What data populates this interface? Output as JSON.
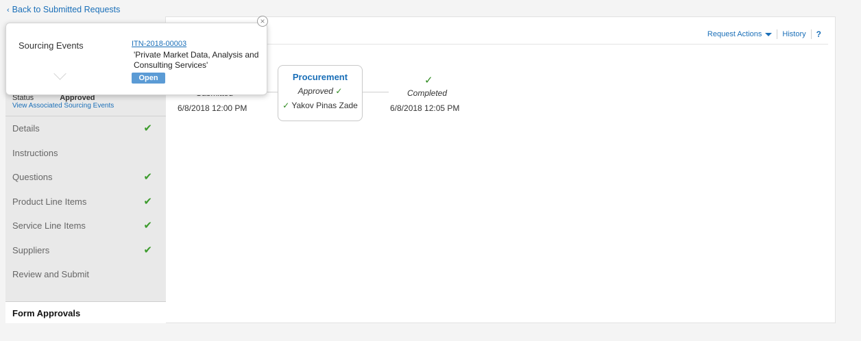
{
  "back_link": {
    "label": "Back to Submitted Requests"
  },
  "actions": {
    "request_actions": "Request Actions",
    "history": "History",
    "help": "?"
  },
  "flow": {
    "submitted": {
      "label": "Submitted",
      "date": "6/8/2018 12:00 PM"
    },
    "procurement": {
      "title": "Procurement",
      "status": "Approved",
      "approver": "Yakov Pinas Zade"
    },
    "completed": {
      "label": "Completed",
      "date": "6/8/2018 12:05 PM"
    }
  },
  "status": {
    "label": "Status",
    "value": "Approved",
    "link": "View Associated Sourcing Events"
  },
  "nav": {
    "items": [
      {
        "label": "Details",
        "check": "✔"
      },
      {
        "label": "Instructions",
        "check": ""
      },
      {
        "label": "Questions",
        "check": "✔"
      },
      {
        "label": "Product Line Items",
        "check": "✔"
      },
      {
        "label": "Service Line Items",
        "check": "✔"
      },
      {
        "label": "Suppliers",
        "check": "✔"
      },
      {
        "label": "Review and Submit",
        "check": ""
      }
    ],
    "active": "Form Approvals"
  },
  "popup": {
    "label": "Sourcing Events",
    "event_id": "ITN-2018-00003",
    "description": "'Private Market Data, Analysis and Consulting Services'",
    "open_label": "Open"
  },
  "icons": {
    "check": "✓",
    "close": "×",
    "back": "‹"
  },
  "colors": {
    "accent": "#1a6fb8",
    "success": "#2d8a1e",
    "open_button": "#5b9bd5"
  }
}
